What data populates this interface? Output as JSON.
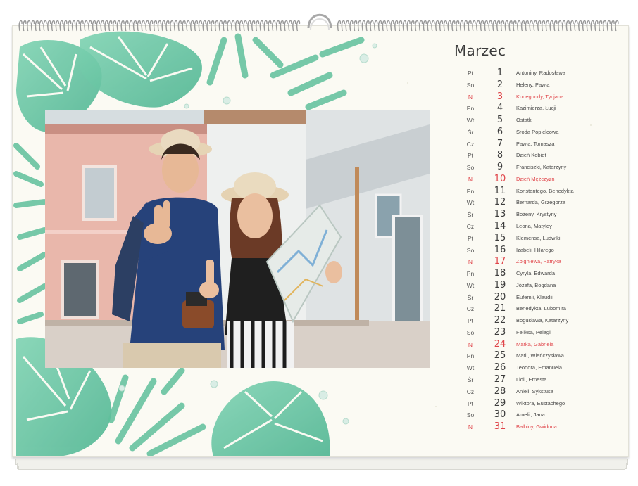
{
  "calendar": {
    "month": "Marzec",
    "colors": {
      "accent_holiday": "#e0454a",
      "text": "#3a3a3a",
      "paper": "#fbfaf3",
      "leaf": "#69c6a3"
    },
    "days": [
      {
        "dow": "Pt",
        "num": "1",
        "names": "Antoniny, Radosława",
        "holiday": false
      },
      {
        "dow": "So",
        "num": "2",
        "names": "Heleny, Pawła",
        "holiday": false
      },
      {
        "dow": "N",
        "num": "3",
        "names": "Kunegundy, Tycjana",
        "holiday": true
      },
      {
        "dow": "Pn",
        "num": "4",
        "names": "Kazimierza, Łucji",
        "holiday": false
      },
      {
        "dow": "Wt",
        "num": "5",
        "names": "Ostatki",
        "holiday": false
      },
      {
        "dow": "Śr",
        "num": "6",
        "names": "Środa Popielcowa",
        "holiday": false
      },
      {
        "dow": "Cz",
        "num": "7",
        "names": "Pawła, Tomasza",
        "holiday": false
      },
      {
        "dow": "Pt",
        "num": "8",
        "names": "Dzień Kobiet",
        "holiday": false
      },
      {
        "dow": "So",
        "num": "9",
        "names": "Franciszki, Katarzyny",
        "holiday": false
      },
      {
        "dow": "N",
        "num": "10",
        "names": "Dzień Mężczyzn",
        "holiday": true
      },
      {
        "dow": "Pn",
        "num": "11",
        "names": "Konstantego, Benedykta",
        "holiday": false
      },
      {
        "dow": "Wt",
        "num": "12",
        "names": "Bernarda, Grzegorza",
        "holiday": false
      },
      {
        "dow": "Śr",
        "num": "13",
        "names": "Bożeny, Krystyny",
        "holiday": false
      },
      {
        "dow": "Cz",
        "num": "14",
        "names": "Leona, Matyldy",
        "holiday": false
      },
      {
        "dow": "Pt",
        "num": "15",
        "names": "Klemensa, Ludwiki",
        "holiday": false
      },
      {
        "dow": "So",
        "num": "16",
        "names": "Izabeli, Hilarego",
        "holiday": false
      },
      {
        "dow": "N",
        "num": "17",
        "names": "Zbigniewa, Patryka",
        "holiday": true
      },
      {
        "dow": "Pn",
        "num": "18",
        "names": "Cyryla, Edwarda",
        "holiday": false
      },
      {
        "dow": "Wt",
        "num": "19",
        "names": "Józefa, Bogdana",
        "holiday": false
      },
      {
        "dow": "Śr",
        "num": "20",
        "names": "Eufemii, Klaudii",
        "holiday": false
      },
      {
        "dow": "Cz",
        "num": "21",
        "names": "Benedykta, Lubomira",
        "holiday": false
      },
      {
        "dow": "Pt",
        "num": "22",
        "names": "Bogusława, Katarzyny",
        "holiday": false
      },
      {
        "dow": "So",
        "num": "23",
        "names": "Feliksa, Pelagii",
        "holiday": false
      },
      {
        "dow": "N",
        "num": "24",
        "names": "Marka, Gabriela",
        "holiday": true
      },
      {
        "dow": "Pn",
        "num": "25",
        "names": "Marii, Wieńczysława",
        "holiday": false
      },
      {
        "dow": "Wt",
        "num": "26",
        "names": "Teodora, Emanuela",
        "holiday": false
      },
      {
        "dow": "Śr",
        "num": "27",
        "names": "Lidii, Ernesta",
        "holiday": false
      },
      {
        "dow": "Cz",
        "num": "28",
        "names": "Anieli, Sykstusa",
        "holiday": false
      },
      {
        "dow": "Pt",
        "num": "29",
        "names": "Wiktora, Eustachego",
        "holiday": false
      },
      {
        "dow": "So",
        "num": "30",
        "names": "Amelii, Jana",
        "holiday": false
      },
      {
        "dow": "N",
        "num": "31",
        "names": "Balbiny, Gwidona",
        "holiday": true
      }
    ]
  }
}
